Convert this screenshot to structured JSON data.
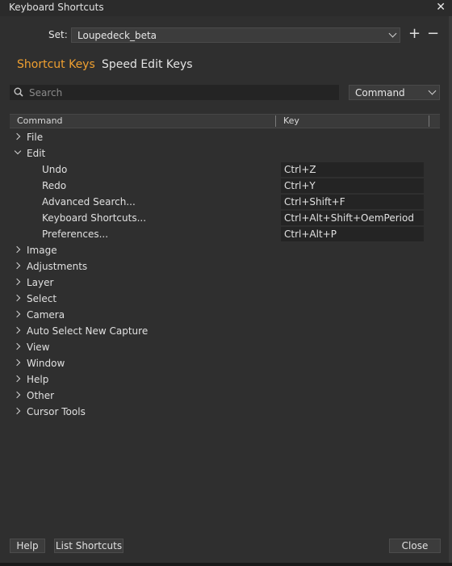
{
  "window": {
    "title": "Keyboard Shortcuts",
    "close_glyph": "✕"
  },
  "set_row": {
    "label": "Set:",
    "value": "Loupedeck_beta",
    "add_glyph": "+",
    "remove_glyph": "−"
  },
  "tabs": [
    {
      "label": "Shortcut Keys",
      "active": true
    },
    {
      "label": "Speed Edit Keys",
      "active": false
    }
  ],
  "search": {
    "placeholder": "Search",
    "value": ""
  },
  "filter": {
    "value": "Command"
  },
  "columns": {
    "command": "Command",
    "key": "Key"
  },
  "tree": [
    {
      "label": "File",
      "expanded": false
    },
    {
      "label": "Edit",
      "expanded": true
    },
    {
      "label": "Undo",
      "key": "Ctrl+Z",
      "child": true
    },
    {
      "label": "Redo",
      "key": "Ctrl+Y",
      "child": true
    },
    {
      "label": "Advanced Search...",
      "key": "Ctrl+Shift+F",
      "child": true
    },
    {
      "label": "Keyboard Shortcuts...",
      "key": "Ctrl+Alt+Shift+OemPeriod",
      "child": true
    },
    {
      "label": "Preferences...",
      "key": "Ctrl+Alt+P",
      "child": true
    },
    {
      "label": "Image",
      "expanded": false
    },
    {
      "label": "Adjustments",
      "expanded": false
    },
    {
      "label": "Layer",
      "expanded": false
    },
    {
      "label": "Select",
      "expanded": false
    },
    {
      "label": "Camera",
      "expanded": false
    },
    {
      "label": "Auto Select New Capture",
      "expanded": false
    },
    {
      "label": "View",
      "expanded": false
    },
    {
      "label": "Window",
      "expanded": false
    },
    {
      "label": "Help",
      "expanded": false
    },
    {
      "label": "Other",
      "expanded": false
    },
    {
      "label": "Cursor Tools",
      "expanded": false
    }
  ],
  "buttons": {
    "help": "Help",
    "list_shortcuts": "List Shortcuts",
    "close": "Close"
  },
  "colors": {
    "accent": "#f0a030",
    "background": "#2f2f2f",
    "field": "#242424"
  }
}
